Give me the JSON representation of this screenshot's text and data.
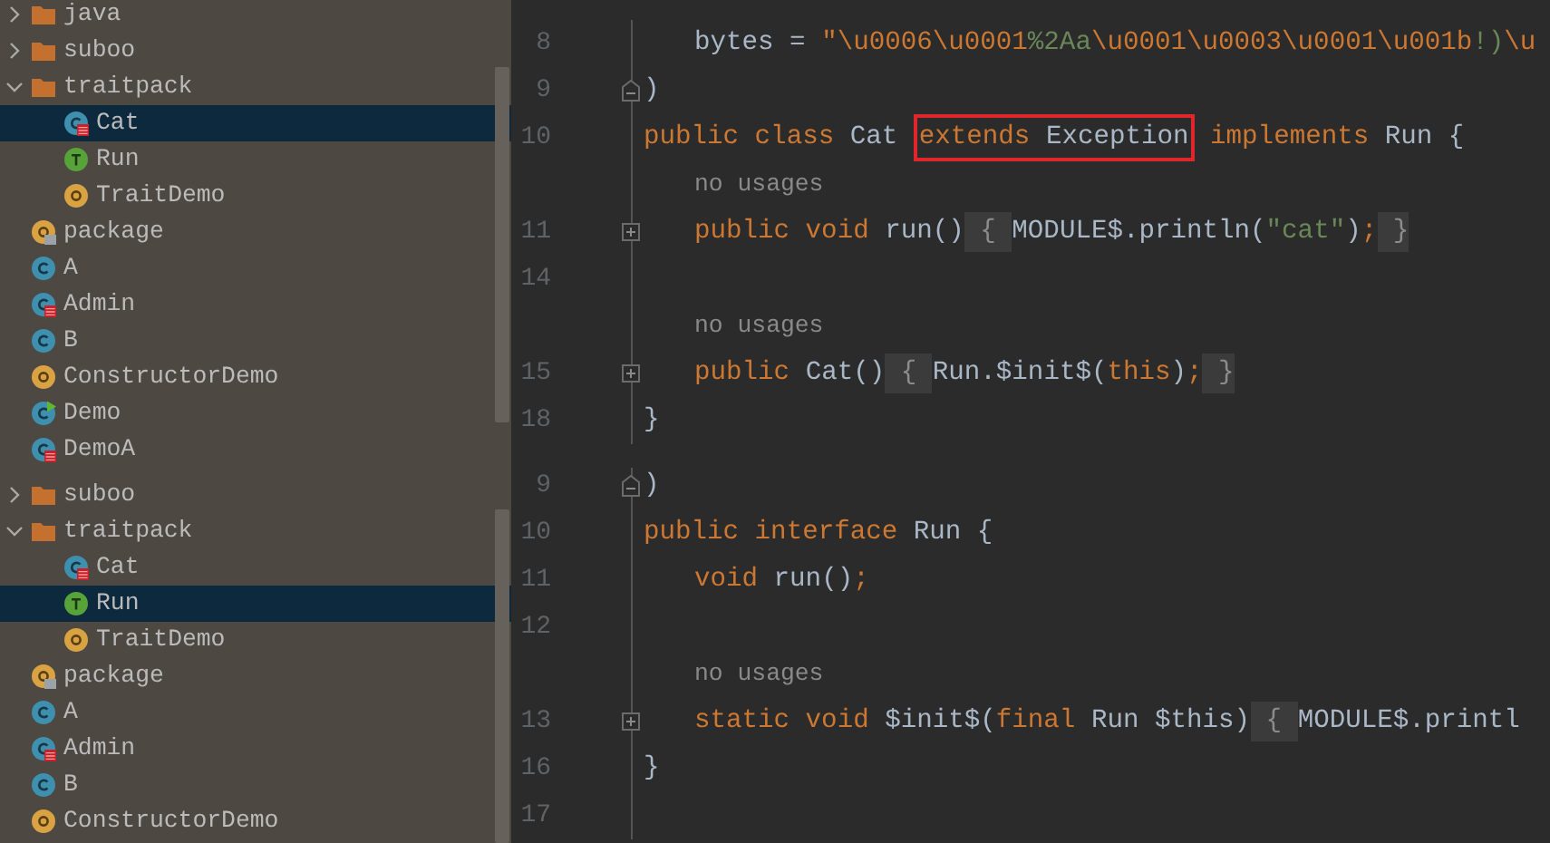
{
  "panels": [
    {
      "tree": [
        {
          "label": "java",
          "kind": "folder",
          "expanded": false,
          "selected": false
        },
        {
          "label": "suboo",
          "kind": "folder",
          "expanded": false,
          "selected": false
        },
        {
          "label": "traitpack",
          "kind": "folder",
          "expanded": true,
          "selected": false,
          "children": [
            {
              "label": "Cat",
              "kind": "class-error",
              "selected": true
            },
            {
              "label": "Run",
              "kind": "trait",
              "selected": false
            },
            {
              "label": "TraitDemo",
              "kind": "object",
              "selected": false
            }
          ]
        },
        {
          "label": "package",
          "kind": "package",
          "selected": false
        },
        {
          "label": "A",
          "kind": "class",
          "selected": false
        },
        {
          "label": "Admin",
          "kind": "class-error",
          "selected": false
        },
        {
          "label": "B",
          "kind": "class",
          "selected": false
        },
        {
          "label": "ConstructorDemo",
          "kind": "object",
          "selected": false
        },
        {
          "label": "Demo",
          "kind": "class-run",
          "selected": false
        },
        {
          "label": "DemoA",
          "kind": "class-error",
          "selected": false
        }
      ],
      "editor": {
        "lines": [
          {
            "kind": "code",
            "number": "8",
            "indented": true,
            "tokens": [
              {
                "kind": "plain",
                "text": "bytes = "
              },
              {
                "kind": "escape",
                "text": "\"\\u0006\\u0001"
              },
              {
                "kind": "string",
                "text": "%2Aa"
              },
              {
                "kind": "escape",
                "text": "\\u0001\\u0003\\u0001\\u001b"
              },
              {
                "kind": "string",
                "text": "!)"
              },
              {
                "kind": "escape",
                "text": "\\u"
              }
            ]
          },
          {
            "kind": "code",
            "number": "9",
            "collapsed": false,
            "indented": false,
            "tokens": [
              {
                "kind": "plain",
                "text": ")"
              }
            ]
          },
          {
            "kind": "code",
            "number": "10",
            "indented": false,
            "tokens": [
              {
                "kind": "keyword",
                "text": "public class "
              },
              {
                "kind": "plain",
                "text": "Cat "
              },
              {
                "kind": "boxed",
                "tokens": [
                  {
                    "kind": "keyword",
                    "text": "extends "
                  },
                  {
                    "kind": "plain",
                    "text": "Exception"
                  }
                ]
              },
              {
                "kind": "keyword",
                "text": " implements "
              },
              {
                "kind": "plain",
                "text": "Run {"
              }
            ]
          },
          {
            "kind": "hint",
            "text": "no usages"
          },
          {
            "kind": "code",
            "number": "11",
            "collapsed": true,
            "indented": true,
            "tokens": [
              {
                "kind": "keyword",
                "text": "public void "
              },
              {
                "kind": "plain",
                "text": "run()"
              },
              {
                "kind": "folded",
                "text": " { "
              },
              {
                "kind": "plain",
                "text": "MODULE$.println("
              },
              {
                "kind": "string",
                "text": "\"cat\""
              },
              {
                "kind": "plain",
                "text": ")"
              },
              {
                "kind": "keyword",
                "text": ";"
              },
              {
                "kind": "folded",
                "text": " }"
              }
            ]
          },
          {
            "kind": "code",
            "number": "14"
          },
          {
            "kind": "hint",
            "text": "no usages"
          },
          {
            "kind": "code",
            "number": "15",
            "collapsed": true,
            "indented": true,
            "tokens": [
              {
                "kind": "keyword",
                "text": "public "
              },
              {
                "kind": "plain",
                "text": "Cat()"
              },
              {
                "kind": "folded",
                "text": " { "
              },
              {
                "kind": "plain",
                "text": "Run.$init$("
              },
              {
                "kind": "keyword",
                "text": "this"
              },
              {
                "kind": "plain",
                "text": ")"
              },
              {
                "kind": "keyword",
                "text": ";"
              },
              {
                "kind": "folded",
                "text": " }"
              }
            ]
          },
          {
            "kind": "code",
            "number": "18",
            "indented": false,
            "tokens": [
              {
                "kind": "plain",
                "text": "}"
              }
            ]
          }
        ]
      }
    },
    {
      "tree": [
        {
          "label": "suboo",
          "kind": "folder",
          "expanded": false,
          "selected": false
        },
        {
          "label": "traitpack",
          "kind": "folder",
          "expanded": true,
          "selected": false,
          "children": [
            {
              "label": "Cat",
              "kind": "class-error",
              "selected": false
            },
            {
              "label": "Run",
              "kind": "trait",
              "selected": true
            },
            {
              "label": "TraitDemo",
              "kind": "object",
              "selected": false
            }
          ]
        },
        {
          "label": "package",
          "kind": "package",
          "selected": false
        },
        {
          "label": "A",
          "kind": "class",
          "selected": false
        },
        {
          "label": "Admin",
          "kind": "class-error",
          "selected": false
        },
        {
          "label": "B",
          "kind": "class",
          "selected": false
        },
        {
          "label": "ConstructorDemo",
          "kind": "object",
          "selected": false
        }
      ],
      "editor": {
        "lines": [
          {
            "kind": "code",
            "number": "9",
            "collapsed": false,
            "indented": false,
            "tokens": [
              {
                "kind": "plain",
                "text": ")"
              }
            ]
          },
          {
            "kind": "code",
            "number": "10",
            "indented": false,
            "tokens": [
              {
                "kind": "keyword",
                "text": "public interface "
              },
              {
                "kind": "plain",
                "text": "Run {"
              }
            ]
          },
          {
            "kind": "code",
            "number": "11",
            "indented": true,
            "tokens": [
              {
                "kind": "keyword",
                "text": "void "
              },
              {
                "kind": "plain",
                "text": "run()"
              },
              {
                "kind": "keyword",
                "text": ";"
              }
            ]
          },
          {
            "kind": "code",
            "number": "12"
          },
          {
            "kind": "hint",
            "text": "no usages"
          },
          {
            "kind": "code",
            "number": "13",
            "collapsed": true,
            "indented": true,
            "tokens": [
              {
                "kind": "keyword",
                "text": "static void "
              },
              {
                "kind": "plain",
                "text": "$init$("
              },
              {
                "kind": "keyword",
                "text": "final "
              },
              {
                "kind": "plain",
                "text": "Run $this)"
              },
              {
                "kind": "folded",
                "text": " { "
              },
              {
                "kind": "plain",
                "text": "MODULE$.printl"
              }
            ]
          },
          {
            "kind": "code",
            "number": "16",
            "indented": false,
            "tokens": [
              {
                "kind": "plain",
                "text": "}"
              }
            ]
          },
          {
            "kind": "code",
            "number": "17"
          }
        ]
      }
    }
  ]
}
